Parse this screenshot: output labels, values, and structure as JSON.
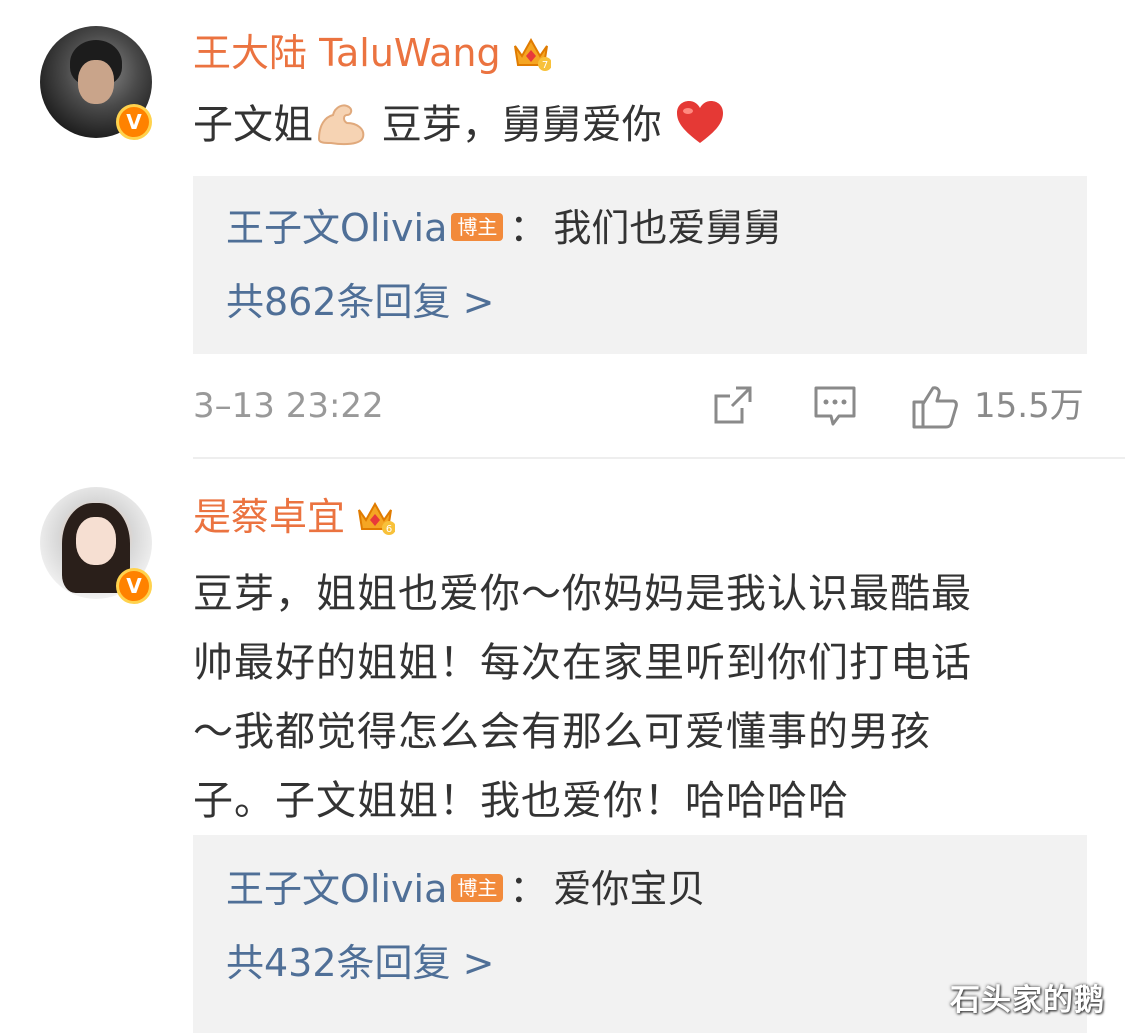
{
  "comments": [
    {
      "username": "王大陆 TaluWang",
      "crown_level": "7",
      "content_before_emoji": "子文姐",
      "content_after_emoji": " 豆芽，舅舅爱你 ",
      "emojis": [
        "flexed-biceps-icon",
        "red-heart-icon"
      ],
      "reply": {
        "user": "王子文Olivia",
        "tag": "博主",
        "separator": "：",
        "text": "我们也爱舅舅"
      },
      "more_replies": "共862条回复 >",
      "time": "3–13 23:22",
      "likes": "15.5万"
    },
    {
      "username": "是蔡卓宜",
      "crown_level": "6",
      "content": "豆芽，姐姐也爱你～你妈妈是我认识最酷最帅最好的姐姐！每次在家里听到你们打电话～我都觉得怎么会有那么可爱懂事的男孩子。子文姐姐！我也爱你！哈哈哈哈",
      "content_lines": [
        "豆芽，姐姐也爱你～你妈妈是我认识最酷最",
        "帅最好的姐姐！每次在家里听到你们打电话",
        "～我都觉得怎么会有那么可爱懂事的男孩",
        "子。子文姐姐！我也爱你！哈哈哈哈"
      ],
      "reply": {
        "user": "王子文Olivia",
        "tag": "博主",
        "separator": "：",
        "text": "爱你宝贝"
      },
      "more_replies": "共432条回复 >"
    }
  ],
  "verified_badge": "V",
  "watermark": "石头家的鹅",
  "colors": {
    "username": "#eb7340",
    "link": "#4f6f97",
    "badge": "#ff8200",
    "meta": "#999999"
  }
}
